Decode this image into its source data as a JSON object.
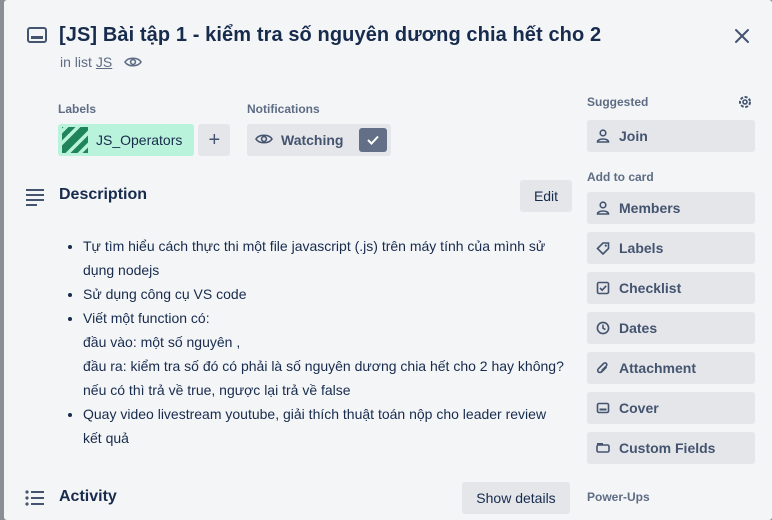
{
  "card": {
    "title": "[JS] Bài tập 1 - kiểm tra số nguyên dương chia hết cho 2",
    "in_list_prefix": "in list",
    "list_name": "JS"
  },
  "labels": {
    "heading": "Labels",
    "items": [
      {
        "name": "JS_Operators",
        "color": "#baf3db"
      }
    ],
    "add_symbol": "+"
  },
  "notifications": {
    "heading": "Notifications",
    "watch_label": "Watching"
  },
  "description": {
    "heading": "Description",
    "edit_label": "Edit",
    "items": [
      {
        "lines": [
          "Tự tìm hiểu cách thực thi một file javascript (.js) trên máy tính của mình sử dụng nodejs"
        ]
      },
      {
        "lines": [
          "Sử dụng công cụ VS code"
        ]
      },
      {
        "lines": [
          "Viết một function có:",
          "đầu vào: một số nguyên ,",
          "đầu ra: kiểm tra số đó có phải là số nguyên dương chia hết cho 2 hay không?",
          "nếu có thì trả về true, ngược lại trả về false"
        ]
      },
      {
        "lines": [
          "Quay video livestream youtube, giải thích thuật toán nộp cho leader review kết quả"
        ]
      }
    ]
  },
  "activity": {
    "heading": "Activity",
    "show_details_label": "Show details"
  },
  "sidebar": {
    "suggested_heading": "Suggested",
    "suggested": [
      {
        "label": "Join",
        "icon": "person-icon"
      }
    ],
    "add_to_card_heading": "Add to card",
    "add_to_card": [
      {
        "label": "Members",
        "icon": "person-icon"
      },
      {
        "label": "Labels",
        "icon": "tag-icon"
      },
      {
        "label": "Checklist",
        "icon": "checkbox-icon"
      },
      {
        "label": "Dates",
        "icon": "clock-icon"
      },
      {
        "label": "Attachment",
        "icon": "paperclip-icon"
      },
      {
        "label": "Cover",
        "icon": "cover-icon"
      },
      {
        "label": "Custom Fields",
        "icon": "custom-fields-icon"
      }
    ],
    "powerups_heading": "Power-Ups"
  },
  "colors": {
    "modal_bg": "#f4f5f7",
    "button_bg": "#e4e6ea",
    "label_green": "#baf3db",
    "text_primary": "#172b4d",
    "text_subtle": "#5e6c84"
  }
}
